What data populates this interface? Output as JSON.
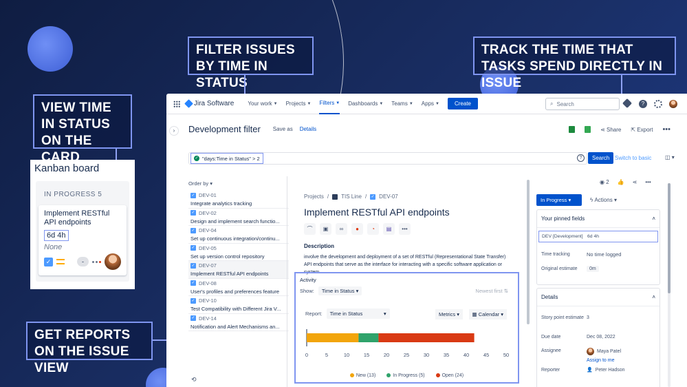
{
  "callouts": {
    "filter": "FILTER ISSUES BY TIME IN STATUS",
    "track": "TRACK THE TIME THAT TASKS SPEND DIRECTLY IN ISSUE",
    "card": "VIEW TIME IN STATUS ON THE CARD",
    "reports": "GET REPORTS ON THE ISSUE VIEW"
  },
  "kanban": {
    "title": "Kanban board",
    "column": "IN PROGRESS  5",
    "card_title": "Implement RESTful API endpoints",
    "card_time": "6d 4h",
    "card_none": "None",
    "card_pill": "-"
  },
  "topnav": {
    "app_name": "Jira Software",
    "items": [
      "Your work",
      "Projects",
      "Filters",
      "Dashboards",
      "Teams",
      "Apps"
    ],
    "create": "Create",
    "search_placeholder": "Search"
  },
  "page": {
    "title": "Development filter",
    "save_as": "Save as",
    "details": "Details",
    "share": "Share",
    "export": "Export"
  },
  "jql": {
    "query": "\"days:Time in Status\" > 2",
    "help": "?",
    "search": "Search",
    "switch": "Switch to basic"
  },
  "list": {
    "order_by": "Order by",
    "items": [
      {
        "key": "DEV-01",
        "title": "Integrate analytics tracking"
      },
      {
        "key": "DEV-02",
        "title": "Design and implement search functio..."
      },
      {
        "key": "DEV-04",
        "title": "Set up continuous integration/continu..."
      },
      {
        "key": "DEV-05",
        "title": "Set up version control repository"
      },
      {
        "key": "DEV-07",
        "title": "Implement RESTful API endpoints"
      },
      {
        "key": "DEV-08",
        "title": "User's profiles and preferences feature"
      },
      {
        "key": "DEV-10",
        "title": "Test Compatibility with Different Jira V..."
      },
      {
        "key": "DEV-14",
        "title": "Notification and Alert Mechanisms an..."
      }
    ]
  },
  "issue": {
    "crumb1": "Projects",
    "crumb2": "TIS Line",
    "crumb3": "DEV-07",
    "title": "Implement RESTful API endpoints",
    "desc_heading": "Description",
    "description": "involve the development and deployment of a set of RESTful (Representational State Transfer) API endpoints that serve as the interface for interacting with a specific software application or system."
  },
  "activity": {
    "heading": "Activity",
    "show_label": "Show:",
    "show_value": "Time in Status",
    "newest": "Newest first",
    "report_label": "Report:",
    "report_value": "Time in Status",
    "metrics": "Metrics",
    "calendar": "Calendar"
  },
  "chart_data": {
    "type": "bar",
    "orientation": "horizontal-stacked",
    "series": [
      {
        "name": "New (13)",
        "values": [
          13
        ],
        "color": "#f2a50c"
      },
      {
        "name": "In Progress (5)",
        "values": [
          5
        ],
        "color": "#2fa36b"
      },
      {
        "name": "Open (24)",
        "values": [
          24
        ],
        "color": "#d93a14"
      }
    ],
    "xlim": [
      0,
      50
    ],
    "xticks": [
      "0",
      "5",
      "10",
      "15",
      "20",
      "25",
      "30",
      "35",
      "40",
      "45",
      "50"
    ]
  },
  "right": {
    "watchers": "2",
    "status": "In Progress",
    "actions": "Actions",
    "pinned_heading": "Your pinned fields",
    "pinned_label": "DEV [Development]",
    "pinned_value": "6d 4h",
    "time_tracking_label": "Time tracking",
    "time_tracking_value": "No time logged",
    "orig_estimate_label": "Original estimate",
    "orig_estimate_value": "0m",
    "details_heading": "Details",
    "story_points_label": "Story point estimate",
    "story_points_value": "3",
    "due_label": "Due date",
    "due_value": "Dec 08, 2022",
    "assignee_label": "Assignee",
    "assignee_value": "Maya Patel",
    "assign_me": "Assign to me",
    "reporter_label": "Reporter",
    "reporter_value": "Peter Hadson"
  },
  "colors": {
    "accent": "#0052cc",
    "callout_border": "#7f95f0"
  }
}
